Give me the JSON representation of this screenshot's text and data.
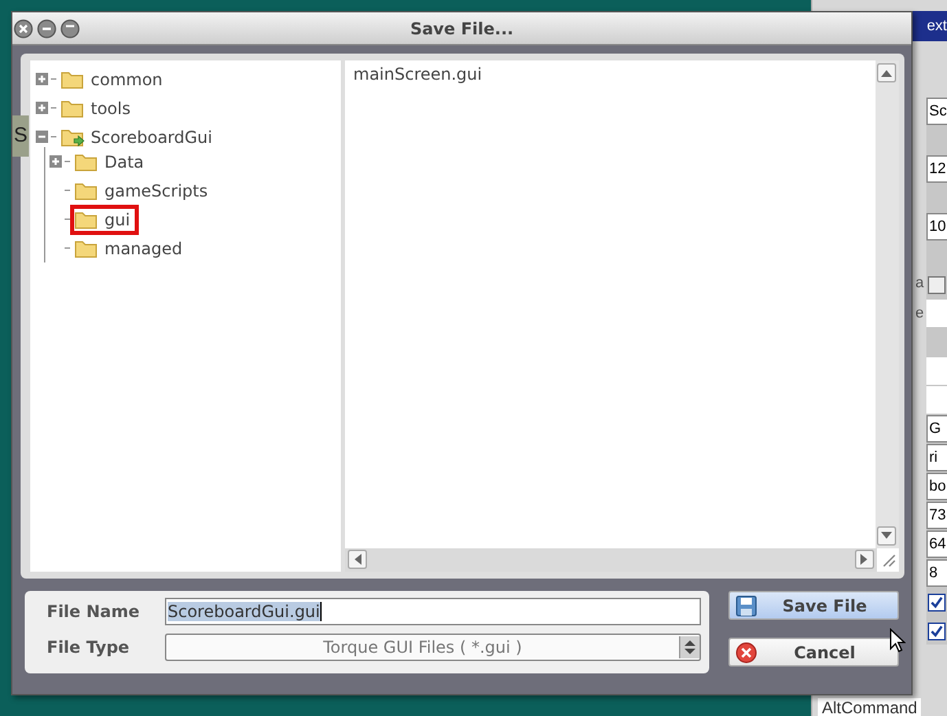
{
  "window": {
    "title": "Save File..."
  },
  "tree": [
    {
      "label": "common",
      "kind": "expandable",
      "expanded": false,
      "selected": false
    },
    {
      "label": "tools",
      "kind": "expandable",
      "expanded": false,
      "selected": false
    },
    {
      "label": "ScoreboardGui",
      "kind": "expandable",
      "expanded": true,
      "selected": false,
      "children": [
        {
          "label": "Data",
          "kind": "expandable",
          "expanded": false,
          "selected": false
        },
        {
          "label": "gameScripts",
          "kind": "leaf",
          "selected": false
        },
        {
          "label": "gui",
          "kind": "leaf",
          "selected": true
        },
        {
          "label": "managed",
          "kind": "leaf",
          "selected": false
        }
      ]
    }
  ],
  "files": [
    {
      "name": "mainScreen.gui",
      "selected": false
    }
  ],
  "file_name": {
    "label": "File Name",
    "value": "ScoreboardGui.gui"
  },
  "file_type": {
    "label": "File Type",
    "value": "Torque GUI Files ( *.gui )"
  },
  "buttons": [
    {
      "label": "Save File",
      "kind": "save"
    },
    {
      "label": "Cancel",
      "kind": "cancel"
    }
  ],
  "background": {
    "header": "ext",
    "left_letter": "S",
    "property_labels": [
      "a",
      "e"
    ],
    "cells": [
      {
        "kind": "text",
        "text": "Sc"
      },
      {
        "kind": "gap"
      },
      {
        "kind": "text",
        "text": "12"
      },
      {
        "kind": "gap"
      },
      {
        "kind": "text",
        "text": "10"
      },
      {
        "kind": "gap"
      },
      {
        "kind": "checkbox",
        "checked": false
      },
      {
        "kind": "blank"
      },
      {
        "kind": "gap"
      },
      {
        "kind": "blank"
      },
      {
        "kind": "blank"
      },
      {
        "kind": "text",
        "text": "G"
      },
      {
        "kind": "text",
        "text": "ri"
      },
      {
        "kind": "text",
        "text": "bo"
      },
      {
        "kind": "text",
        "text": "73"
      },
      {
        "kind": "text",
        "text": "64"
      },
      {
        "kind": "text",
        "text": "8"
      },
      {
        "kind": "checkbox",
        "checked": true
      },
      {
        "kind": "checkbox",
        "checked": true
      }
    ],
    "bottom_label": "AltCommand"
  }
}
